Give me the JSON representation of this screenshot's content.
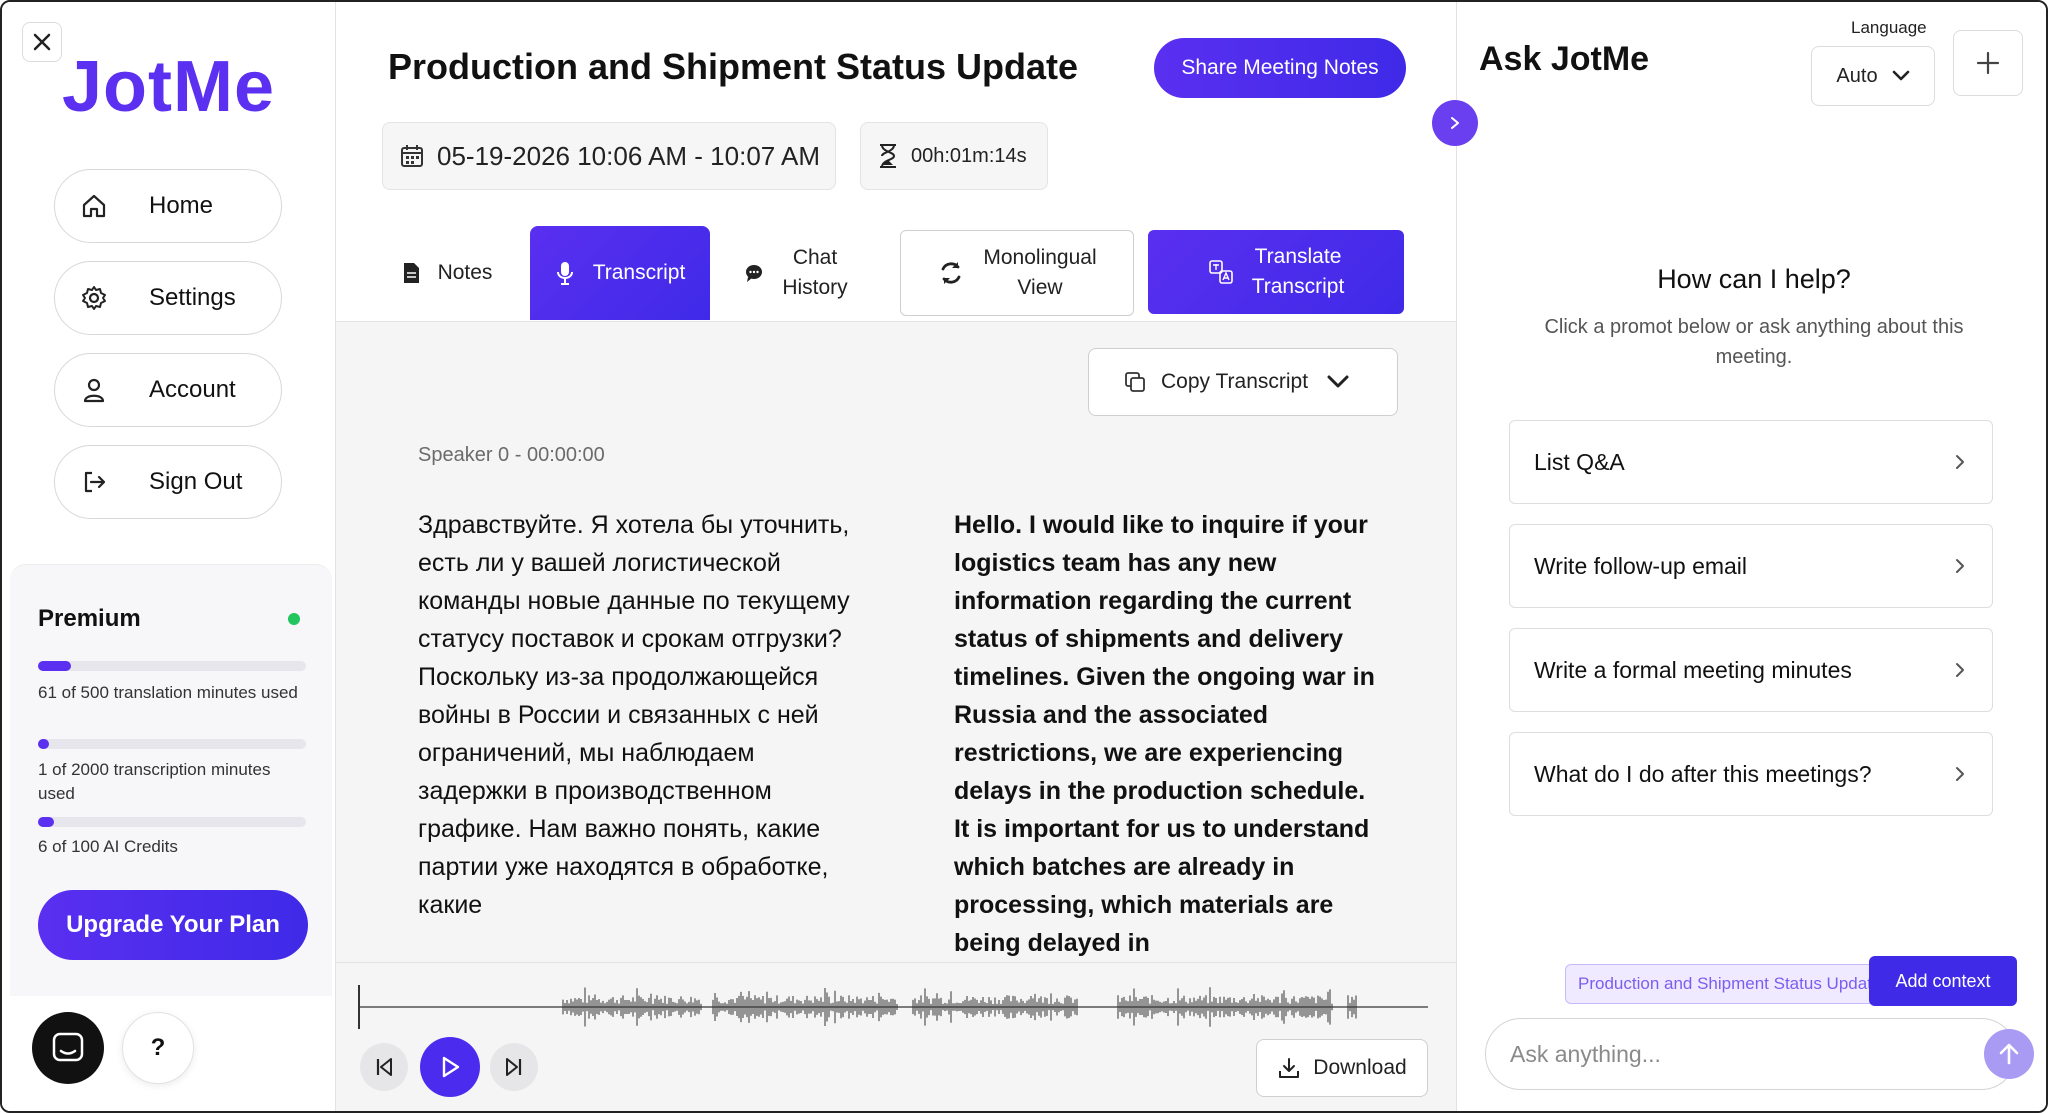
{
  "sidebar": {
    "logo": "JotMe",
    "nav": [
      {
        "label": "Home",
        "icon": "home-icon"
      },
      {
        "label": "Settings",
        "icon": "gear-icon"
      },
      {
        "label": "Account",
        "icon": "user-icon"
      },
      {
        "label": "Sign Out",
        "icon": "sign-out-icon"
      }
    ],
    "premium": {
      "title": "Premium",
      "status_color": "#22c55e",
      "usage": [
        {
          "label": "61 of 500 translation minutes used",
          "used": 61,
          "total": 500
        },
        {
          "label": "1 of 2000 transcription minutes used",
          "used": 1,
          "total": 2000
        },
        {
          "label": "6 of 100 AI Credits",
          "used": 6,
          "total": 100
        }
      ],
      "upgrade_label": "Upgrade Your Plan"
    },
    "help_label": "?"
  },
  "main": {
    "title": "Production and Shipment Status Update",
    "share_label": "Share Meeting Notes",
    "date_range": "05-19-2026 10:06 AM - 10:07 AM",
    "duration": "00h:01m:14s",
    "tabs": {
      "notes": "Notes",
      "transcript": "Transcript",
      "chat_line1": "Chat",
      "chat_line2": "History",
      "mono_line1": "Monolingual",
      "mono_line2": "View",
      "translate_line1": "Translate",
      "translate_line2": "Transcript"
    },
    "copy_label": "Copy Transcript",
    "speaker": "Speaker 0 - 00:00:00",
    "original_text": "Здравствуйте. Я хотела бы уточнить, есть ли у вашей логистической команды новые данные по текущему статусу поставок и срокам отгрузки? Поскольку из-за продолжающейся войны в России и связанных с ней ограничений, мы наблюдаем задержки в производственном графике. Нам важно понять, какие партии уже находятся в обработке, какие",
    "translated_text": "Hello. I would like to inquire if your logistics team has any new information regarding the current status of shipments and delivery timelines. Given the ongoing war in Russia and the associated restrictions, we are experiencing delays in the production schedule. It is important for us to understand which batches are already in processing, which materials are being delayed in",
    "download_label": "Download"
  },
  "right": {
    "title": "Ask JotMe",
    "language_label": "Language",
    "language_value": "Auto",
    "help_title": "How can I help?",
    "help_sub": "Click a promot below or ask anything about this meeting.",
    "prompts": [
      "List Q&A",
      "Write follow-up email",
      "Write a formal meeting minutes",
      "What do I do after this meetings?"
    ],
    "context_chip": "Production and Shipment Status Update",
    "add_context_label": "Add context",
    "input_placeholder": "Ask anything..."
  },
  "colors": {
    "accent": "#5b30f0",
    "accent_dark": "#3f2ae8"
  }
}
